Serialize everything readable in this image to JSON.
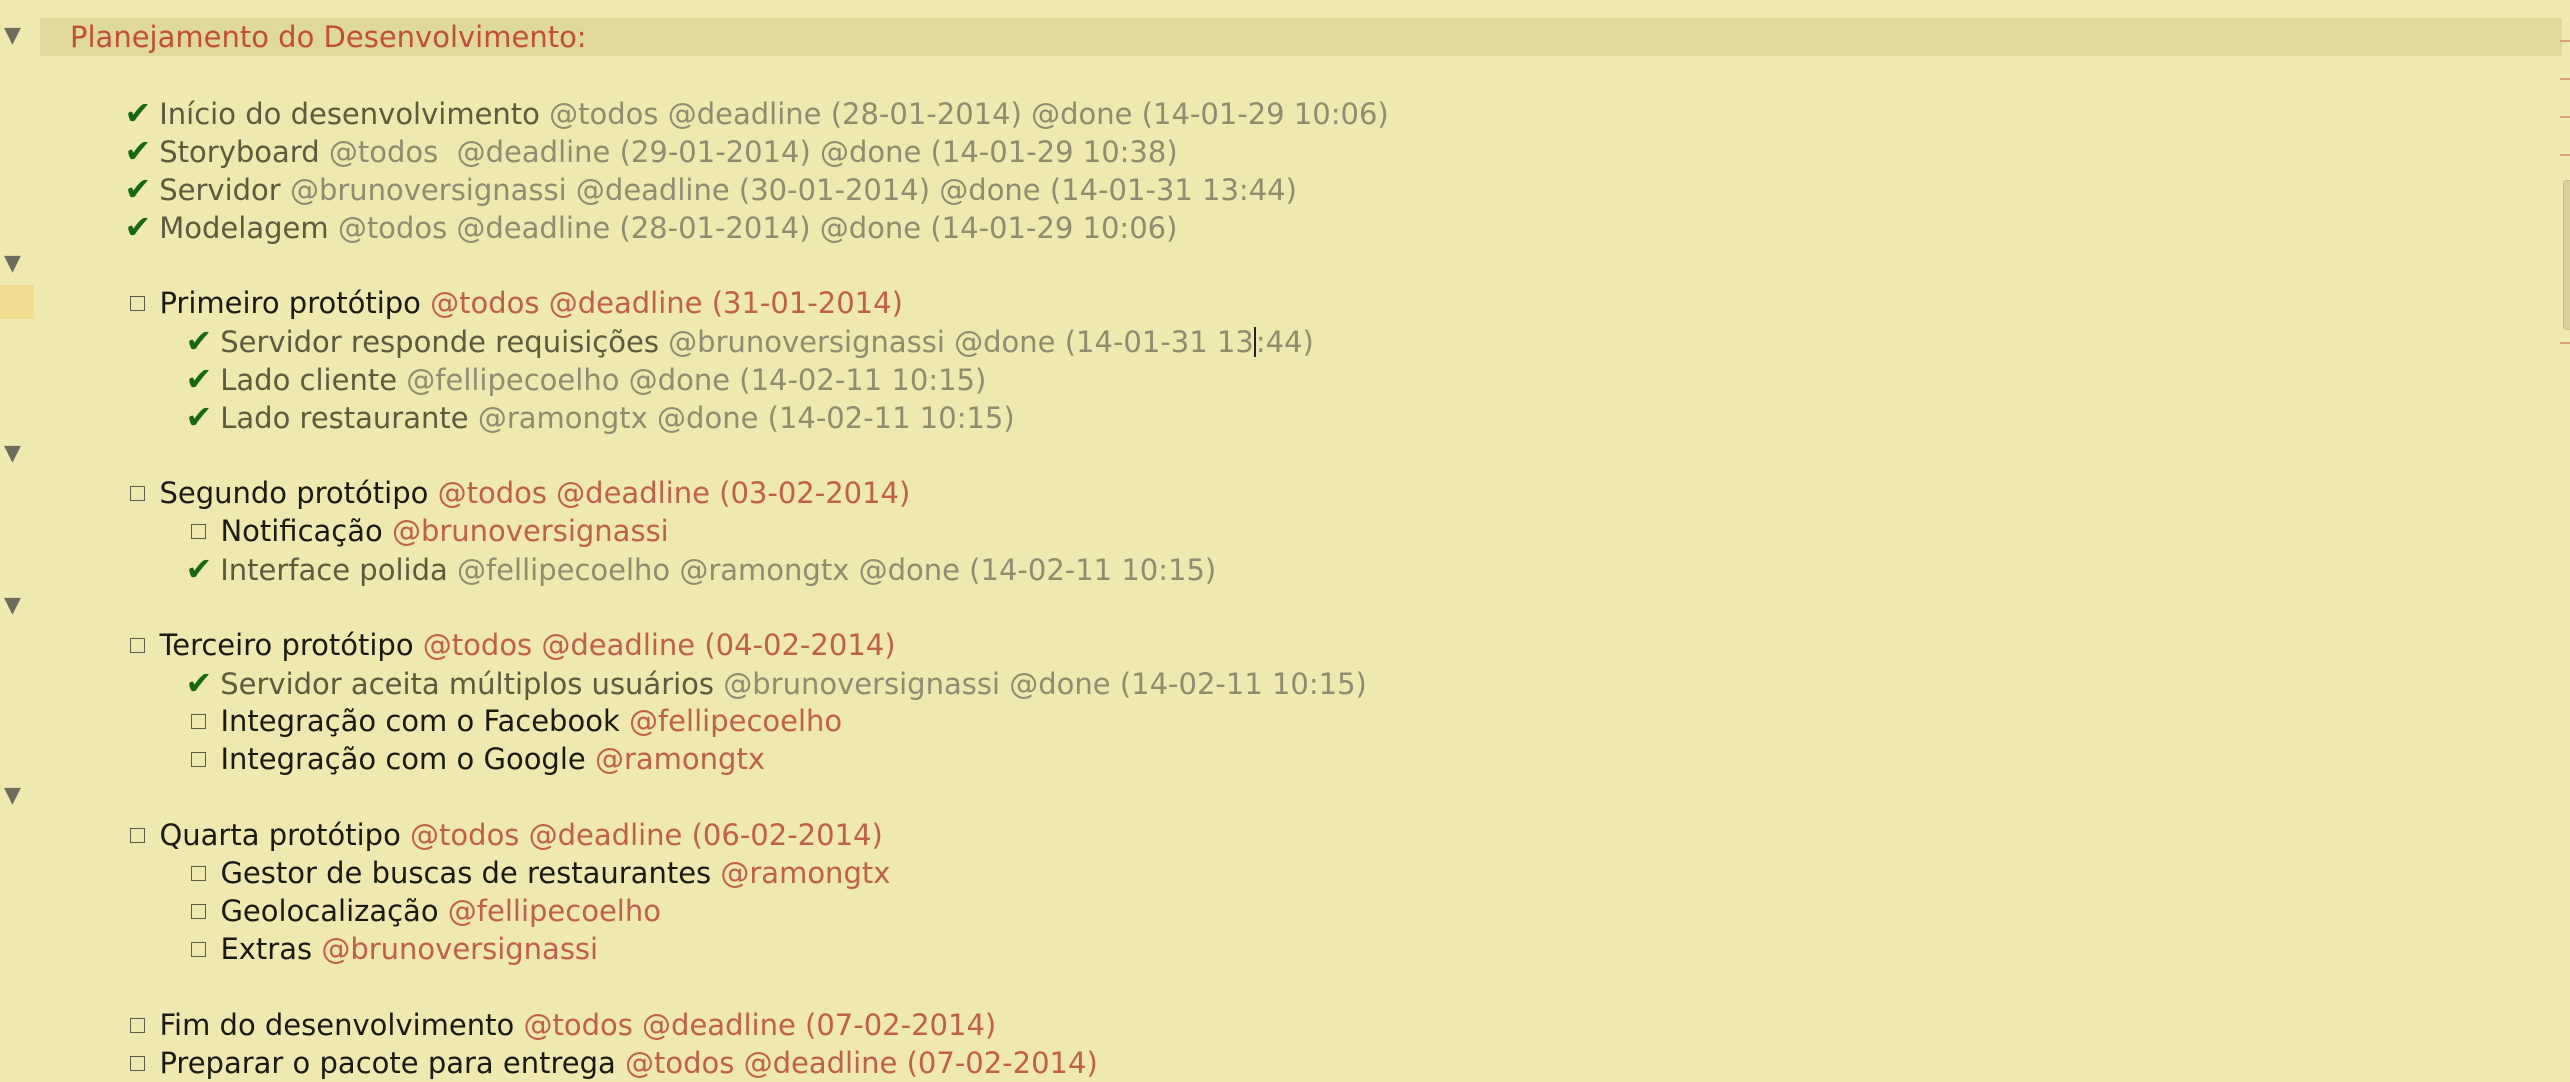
{
  "project": {
    "title": "Planejamento do Desenvolvimento:"
  },
  "items": [
    {
      "status": "done",
      "text": "Início do desenvolvimento",
      "tags": "@todos @deadline (28-01-2014) @done (14-01-29 10:06)"
    },
    {
      "status": "done",
      "text": "Storyboard",
      "tags": "@todos  @deadline (29-01-2014) @done (14-01-29 10:38)"
    },
    {
      "status": "done",
      "text": "Servidor",
      "tags": "@brunoversignassi @deadline (30-01-2014) @done (14-01-31 13:44)"
    },
    {
      "status": "done",
      "text": "Modelagem",
      "tags": "@todos @deadline (28-01-2014) @done (14-01-29 10:06)"
    },
    {
      "status": "todo",
      "text": "Primeiro protótipo",
      "tags": "@todos @deadline (31-01-2014)"
    },
    {
      "status": "done",
      "text": "Servidor responde requisições",
      "tags_before_cursor": "@brunoversignassi @done (14-01-31 13",
      "tags_after_cursor": ":44)"
    },
    {
      "status": "done",
      "text": "Lado cliente",
      "tags": "@fellipecoelho @done (14-02-11 10:15)"
    },
    {
      "status": "done",
      "text": "Lado restaurante",
      "tags": "@ramongtx @done (14-02-11 10:15)"
    },
    {
      "status": "todo",
      "text": "Segundo protótipo",
      "tags": "@todos @deadline (03-02-2014)"
    },
    {
      "status": "todo",
      "text": "Notificação",
      "tags": "@brunoversignassi"
    },
    {
      "status": "done",
      "text": "Interface polida",
      "tags": "@fellipecoelho @ramongtx @done (14-02-11 10:15)"
    },
    {
      "status": "todo",
      "text": "Terceiro protótipo",
      "tags": "@todos @deadline (04-02-2014)"
    },
    {
      "status": "done",
      "text": "Servidor aceita múltiplos usuários",
      "tags": "@brunoversignassi @done (14-02-11 10:15)"
    },
    {
      "status": "todo",
      "text": "Integração com o Facebook",
      "tags": "@fellipecoelho"
    },
    {
      "status": "todo",
      "text": "Integração com o Google",
      "tags": "@ramongtx"
    },
    {
      "status": "todo",
      "text": "Quarta protótipo",
      "tags": "@todos @deadline (06-02-2014)"
    },
    {
      "status": "todo",
      "text": "Gestor de buscas de restaurantes",
      "tags": "@ramongtx"
    },
    {
      "status": "todo",
      "text": "Geolocalização",
      "tags": "@fellipecoelho"
    },
    {
      "status": "todo",
      "text": "Extras",
      "tags": "@brunoversignassi"
    },
    {
      "status": "todo",
      "text": "Fim do desenvolvimento",
      "tags": "@todos @deadline (07-02-2014)"
    },
    {
      "status": "todo",
      "text": "Preparar o pacote para entrega",
      "tags": "@todos @deadline (07-02-2014)"
    }
  ],
  "icons": {
    "fold": "disclosure-triangle-icon",
    "done": "checkmark-icon",
    "todo": "checkbox-icon"
  },
  "colors": {
    "background": "#efe8b0",
    "project": "#c24f35",
    "check": "#176717",
    "todo_tag": "#c0604a",
    "done_tag": "#908c70"
  }
}
